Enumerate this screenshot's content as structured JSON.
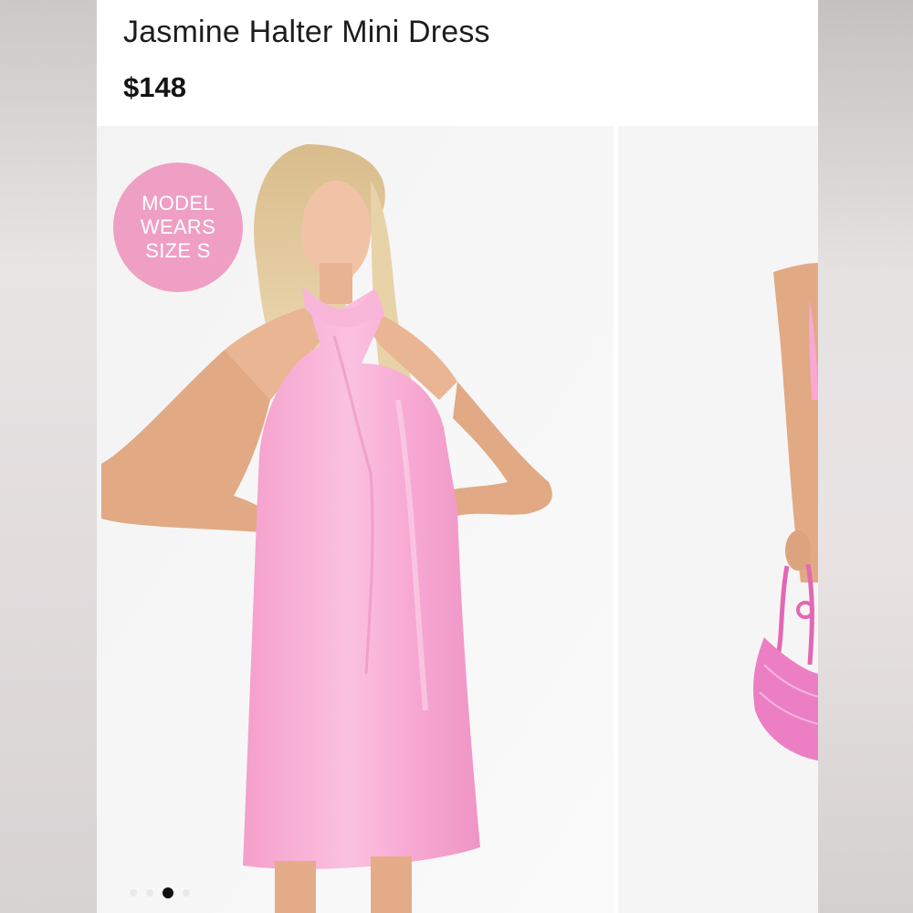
{
  "product": {
    "title": "Jasmine Halter Mini Dress",
    "price": "$148"
  },
  "badge": {
    "lines": [
      "MODEL",
      "WEARS",
      "SIZE S"
    ],
    "color": "#ef9fc4"
  },
  "gallery": {
    "slide_count": 4,
    "active_slide": 3,
    "dress_color": "#f7a9d2"
  },
  "icons": [
    "carousel-dot"
  ]
}
